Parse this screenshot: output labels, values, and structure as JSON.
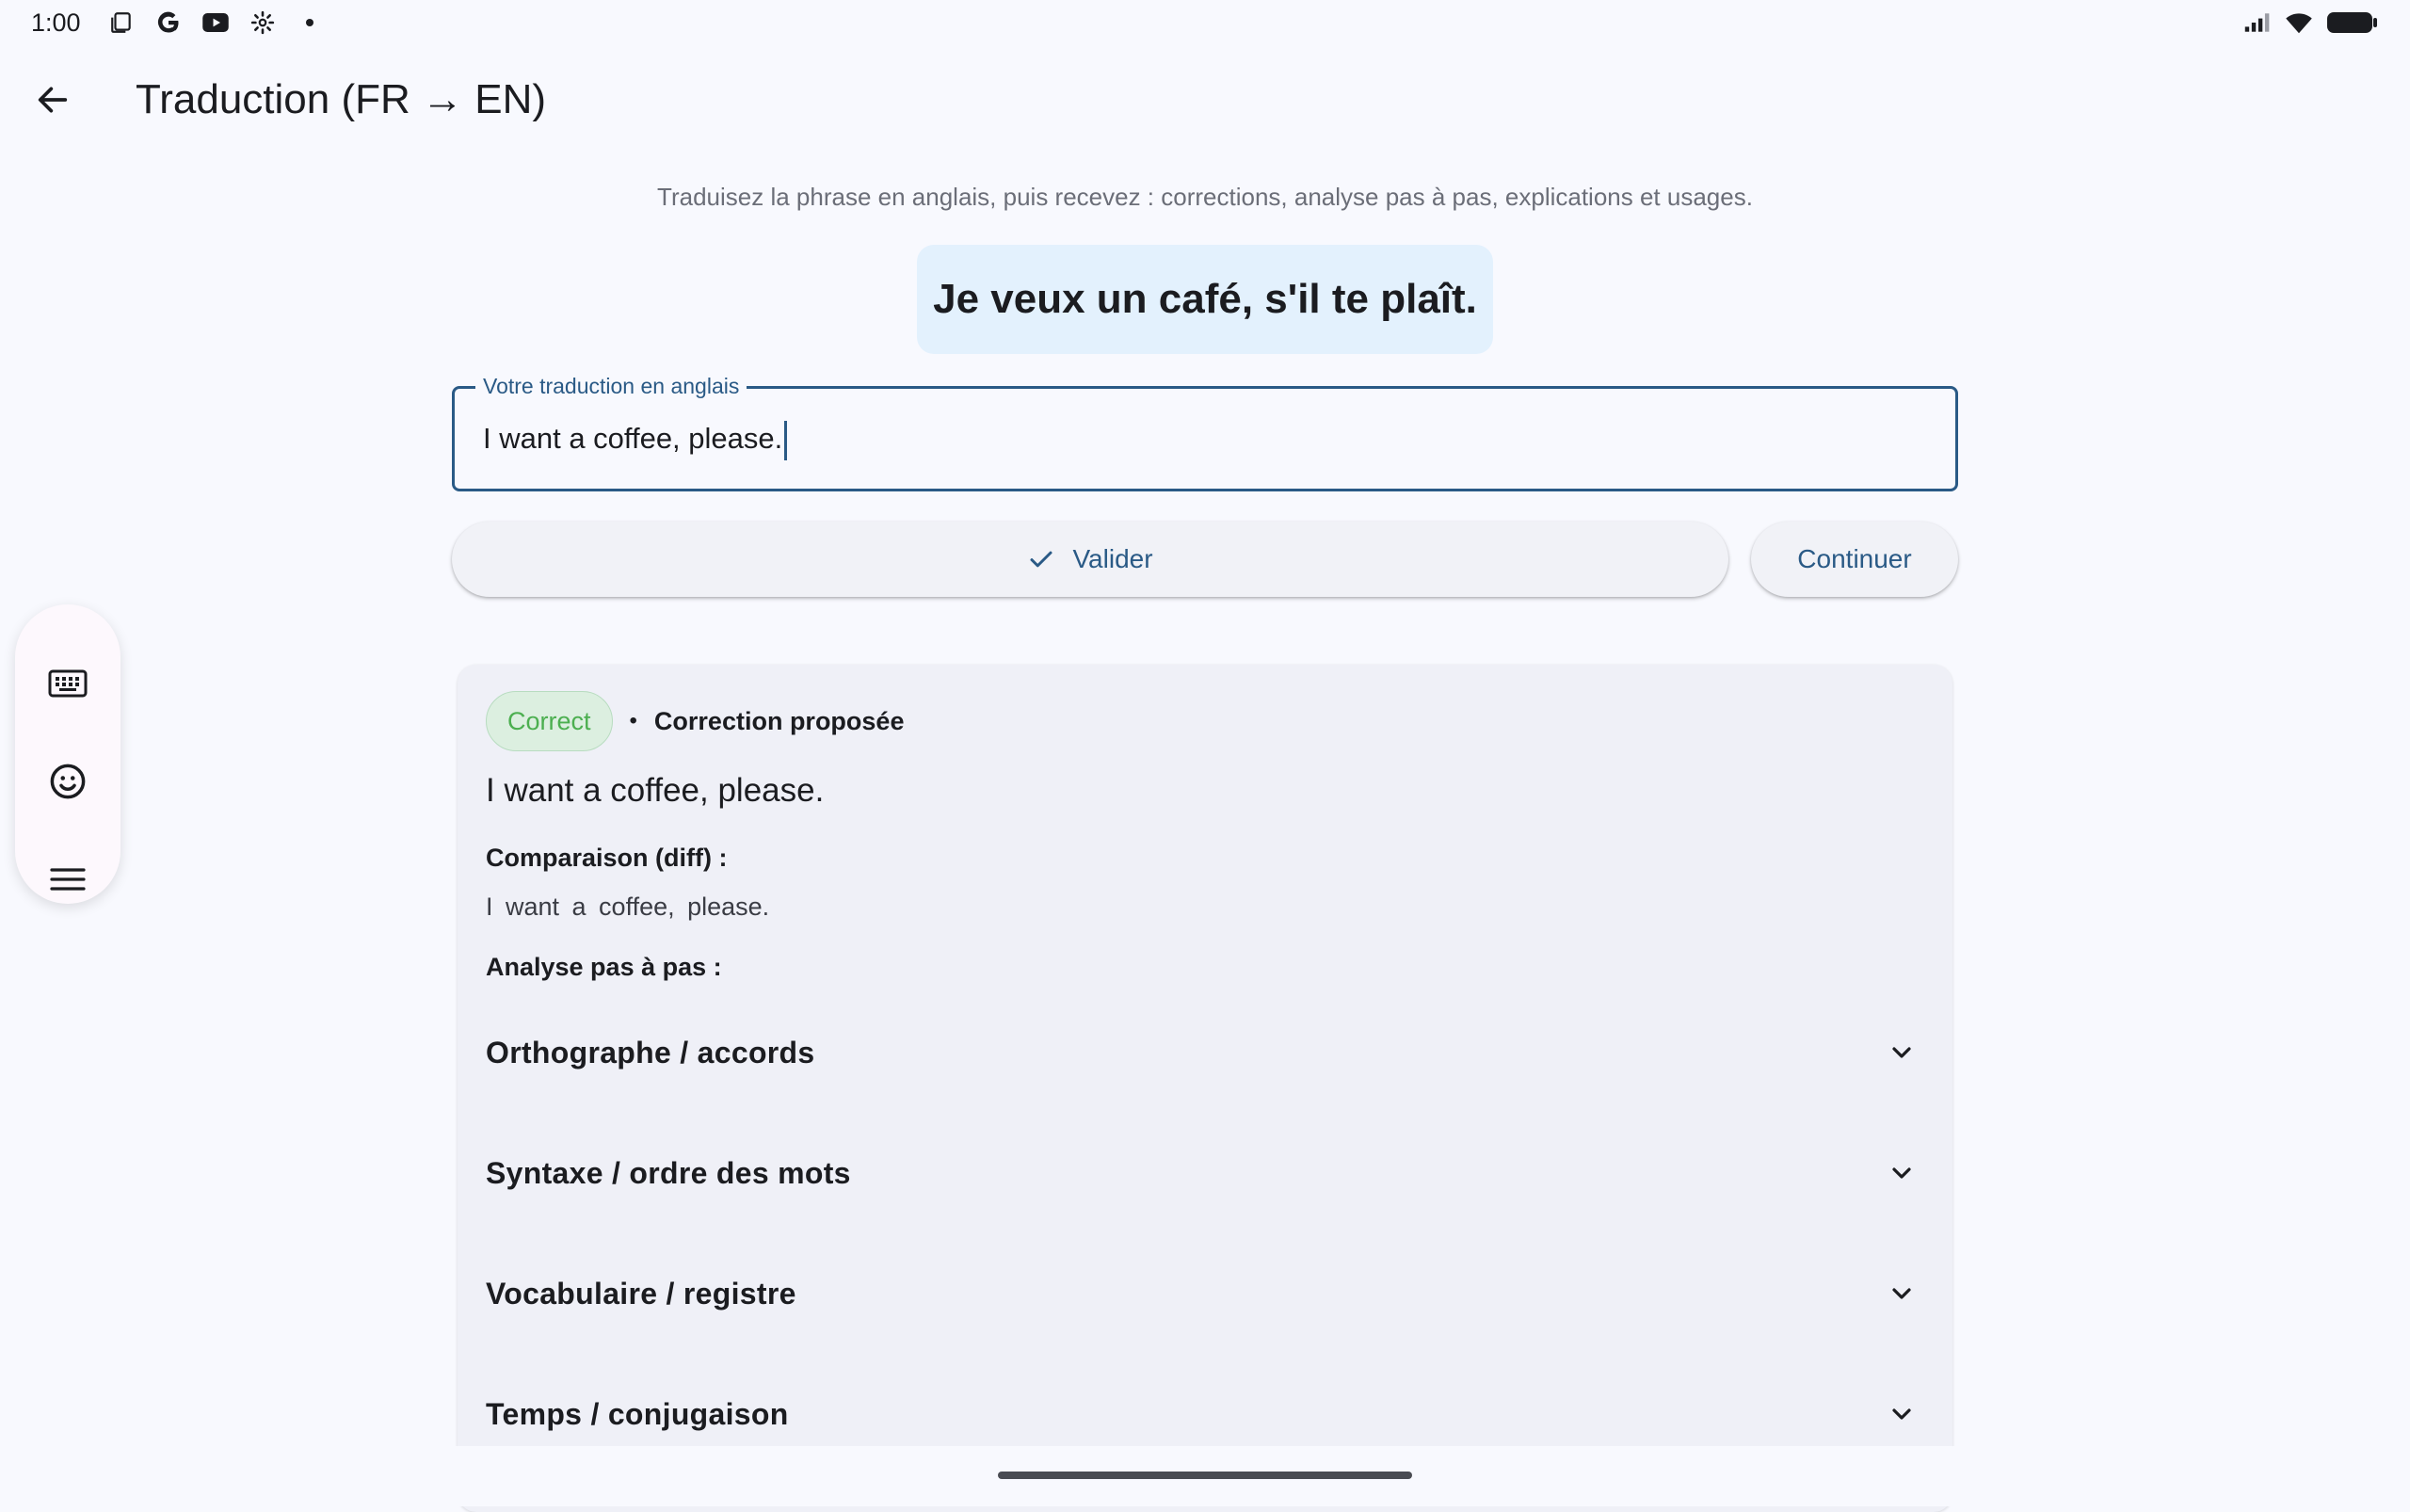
{
  "status_bar": {
    "time": "1:00"
  },
  "app_bar": {
    "title": "Traduction (FR → EN)"
  },
  "instructions": "Traduisez la phrase en anglais, puis recevez : corrections, analyse pas à pas, explications et usages.",
  "sentence": "Je veux un café, s'il te plaît.",
  "translation_field": {
    "label": "Votre traduction en anglais",
    "value": "I want a coffee, please."
  },
  "actions": {
    "validate_label": "Valider",
    "continue_label": "Continuer"
  },
  "result": {
    "badge": "Correct",
    "separator": "•",
    "correction_label": "Correction proposée",
    "corrected_text": "I want a coffee, please.",
    "diff_heading": "Comparaison (diff) :",
    "diff_text": "I want a coffee, please.",
    "analysis_heading": "Analyse pas à pas :",
    "sections": [
      {
        "label": "Orthographe / accords"
      },
      {
        "label": "Syntaxe / ordre des mots"
      },
      {
        "label": "Vocabulaire / registre"
      },
      {
        "label": "Temps / conjugaison"
      }
    ]
  },
  "colors": {
    "primary": "#2a5a86",
    "bubble": "#e3f1fd",
    "success": "#4caf50",
    "background": "#f8f9fe"
  },
  "icons": {
    "back": "arrow-left-icon",
    "validate": "check-icon",
    "side_toolbar": [
      "keyboard-icon",
      "emoji-icon",
      "menu-icon"
    ],
    "accordion": "chevron-down-icon"
  }
}
